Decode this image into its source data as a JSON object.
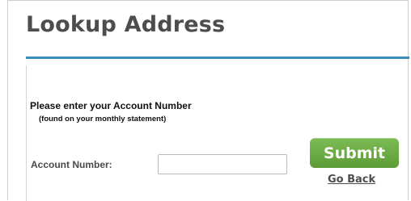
{
  "header": {
    "title": "Lookup Address"
  },
  "form": {
    "instruction": "Please enter your Account Number",
    "hint": "(found on your monthly statement)",
    "account_label": "Account Number:",
    "account_value": "",
    "account_placeholder": "",
    "submit_label": "Submit",
    "back_label": "Go Back"
  },
  "colors": {
    "accent_rule": "#3a8ebd",
    "submit_green": "#6aab42",
    "title_text": "#4d4d4d"
  }
}
